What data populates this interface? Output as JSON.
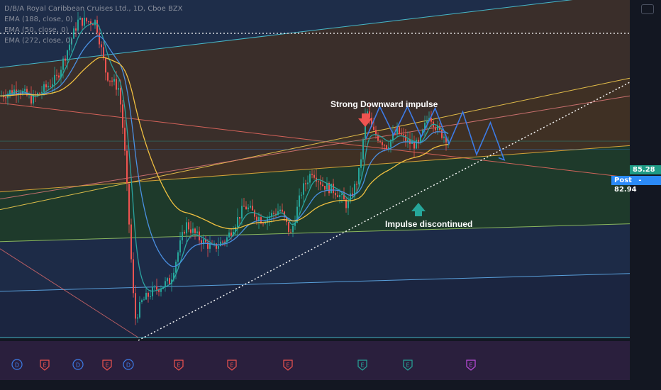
{
  "header": {
    "title": "D/B/A Royal Caribbean Cruises Ltd., 1D, Cboe BZX",
    "indicators": [
      "EMA (188, close, 0)",
      "EMA (50, close, 0)",
      "EMA (272, close, 0)"
    ]
  },
  "price_badges": {
    "last": "85.28",
    "post_label": "Post",
    "post_value": "82.94"
  },
  "annotations": {
    "top": "Strong Downward impulse",
    "bottom": "Impulse discontinued"
  },
  "events": [
    "D",
    "E",
    "D",
    "E",
    "D",
    "E",
    "E",
    "E",
    "E",
    "E",
    "E"
  ],
  "colors": {
    "background": "#131722",
    "up": "#26a69a",
    "down": "#ef5350",
    "projection": "#3d7be6",
    "badge_last": "#1e9b86",
    "badge_post": "#2b8af7"
  },
  "chart_data": {
    "type": "candlestick",
    "ylim": [
      30,
      125
    ],
    "last_price": 85.28,
    "post_price": 82.94,
    "levels": [
      122.5,
      84.5
    ],
    "channel_lines": [
      {
        "color": "#ffd54f",
        "y_start": 66,
        "y_end": 103
      },
      {
        "color": "#ef6c62",
        "y_start": 96,
        "y_end": 75
      },
      {
        "color": "#e07a7a",
        "y_start": 69,
        "y_end": 98
      },
      {
        "color": "#f0b63b",
        "y_start": 71,
        "y_end": 84
      },
      {
        "color": "#9ccc65",
        "y_start": 57,
        "y_end": 62
      },
      {
        "color": "#64b5f6",
        "y_start": 43,
        "y_end": 48
      },
      {
        "color": "#4dd0e1",
        "y_start": 30,
        "y_end": 30
      },
      {
        "color": "#4dd0e1",
        "y_start": 106,
        "y_end": 127
      }
    ],
    "projection": [
      86.0,
      95.0,
      87.0,
      95.0,
      86.5,
      94.5,
      84.5,
      93.5,
      81.5,
      90.5,
      80.0
    ]
  }
}
